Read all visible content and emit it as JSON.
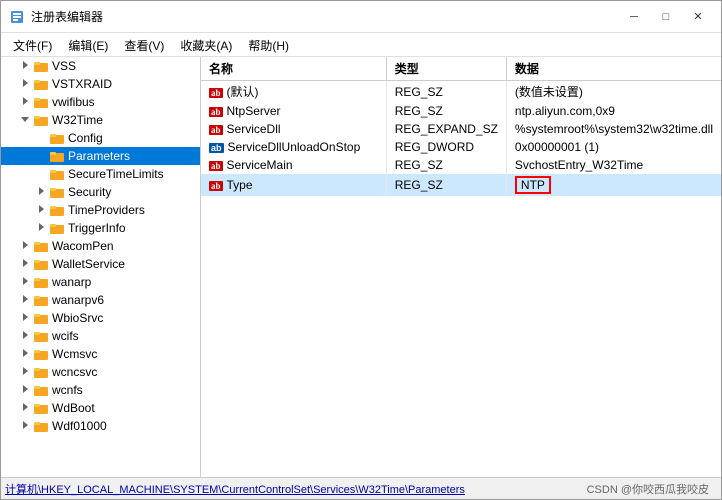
{
  "window": {
    "title": "注册表编辑器",
    "controls": {
      "minimize": "─",
      "maximize": "□",
      "close": "✕"
    }
  },
  "menu": {
    "items": [
      "文件(F)",
      "编辑(E)",
      "查看(V)",
      "收藏夹(A)",
      "帮助(H)"
    ]
  },
  "tree": {
    "items": [
      {
        "label": "VSS",
        "indent": 1,
        "expand": "›",
        "type": "folder"
      },
      {
        "label": "VSTXRAID",
        "indent": 1,
        "expand": "›",
        "type": "folder"
      },
      {
        "label": "vwifibus",
        "indent": 1,
        "expand": "›",
        "type": "folder"
      },
      {
        "label": "W32Time",
        "indent": 1,
        "expand": "∨",
        "type": "folder",
        "expanded": true
      },
      {
        "label": "Config",
        "indent": 2,
        "expand": "",
        "type": "folder"
      },
      {
        "label": "Parameters",
        "indent": 2,
        "expand": "",
        "type": "folder",
        "selected": true
      },
      {
        "label": "SecureTimeLimits",
        "indent": 2,
        "expand": "",
        "type": "folder"
      },
      {
        "label": "Security",
        "indent": 2,
        "expand": "›",
        "type": "folder"
      },
      {
        "label": "TimeProviders",
        "indent": 2,
        "expand": "›",
        "type": "folder"
      },
      {
        "label": "TriggerInfo",
        "indent": 2,
        "expand": "›",
        "type": "folder"
      },
      {
        "label": "WacomPen",
        "indent": 1,
        "expand": "›",
        "type": "folder"
      },
      {
        "label": "WalletService",
        "indent": 1,
        "expand": "›",
        "type": "folder"
      },
      {
        "label": "wanarp",
        "indent": 1,
        "expand": "›",
        "type": "folder"
      },
      {
        "label": "wanarpv6",
        "indent": 1,
        "expand": "›",
        "type": "folder"
      },
      {
        "label": "WbioSrvc",
        "indent": 1,
        "expand": "›",
        "type": "folder"
      },
      {
        "label": "wcifs",
        "indent": 1,
        "expand": "›",
        "type": "folder"
      },
      {
        "label": "Wcmsvc",
        "indent": 1,
        "expand": "›",
        "type": "folder"
      },
      {
        "label": "wcncsvc",
        "indent": 1,
        "expand": "›",
        "type": "folder"
      },
      {
        "label": "wcnfs",
        "indent": 1,
        "expand": "›",
        "type": "folder"
      },
      {
        "label": "WdBoot",
        "indent": 1,
        "expand": "›",
        "type": "folder"
      },
      {
        "label": "Wdf01000",
        "indent": 1,
        "expand": "›",
        "type": "folder"
      }
    ]
  },
  "table": {
    "headers": [
      "名称",
      "类型",
      "数据"
    ],
    "rows": [
      {
        "name": "(默认)",
        "type": "REG_SZ",
        "data": "(数值未设置)",
        "icon": "ab",
        "selected": false
      },
      {
        "name": "NtpServer",
        "type": "REG_SZ",
        "data": "ntp.aliyun.com,0x9",
        "icon": "ab",
        "selected": false
      },
      {
        "name": "ServiceDll",
        "type": "REG_EXPAND_SZ",
        "data": "%systemroot%\\system32\\w32time.dll",
        "icon": "ab",
        "selected": false
      },
      {
        "name": "ServiceDllUnloadOnStop",
        "type": "REG_DWORD",
        "data": "0x00000001 (1)",
        "icon": "dword",
        "selected": false
      },
      {
        "name": "ServiceMain",
        "type": "REG_SZ",
        "data": "SvchostEntry_W32Time",
        "icon": "ab",
        "selected": false
      },
      {
        "name": "Type",
        "type": "REG_SZ",
        "data": "NTP",
        "icon": "ab",
        "selected": true,
        "highlight_data": true
      }
    ]
  },
  "status": {
    "path": "计算机\\HKEY_LOCAL_MACHINE\\SYSTEM\\CurrentControlSet\\Services\\W32Time\\Parameters",
    "brand": "CSDN @你咬西瓜我咬皮"
  }
}
